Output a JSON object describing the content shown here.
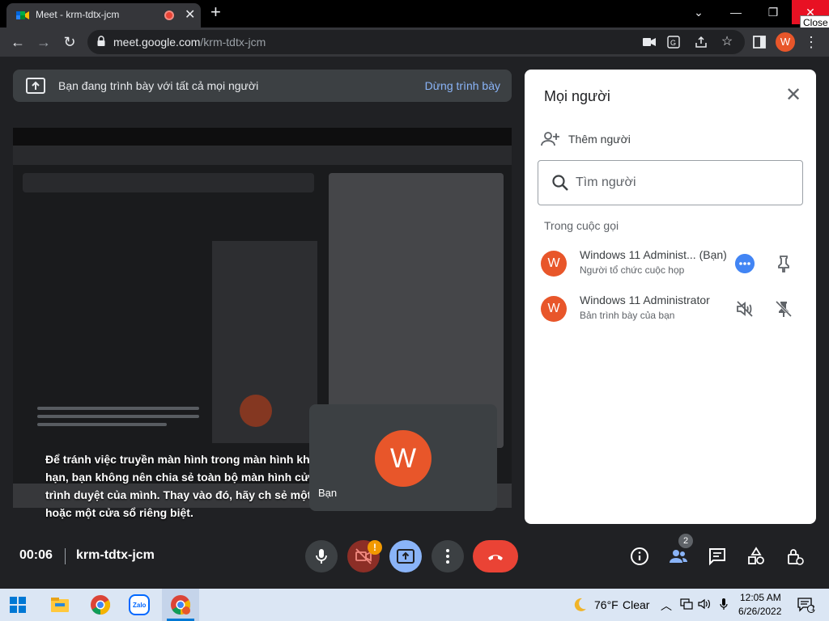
{
  "browser": {
    "tab_title": "Meet - krm-tdtx-jcm",
    "new_tab_symbol": "+",
    "close_tooltip": "Close",
    "url_host": "meet.google.com",
    "url_path": "/krm-tdtx-jcm",
    "profile_initial": "W"
  },
  "banner": {
    "text": "Bạn đang trình bày với tất cả mọi người",
    "stop_label": "Dừng trình bày"
  },
  "stage": {
    "caption": "Để tránh việc truyền màn hình trong màn hình kh giới hạn, bạn không nên chia sẻ toàn bộ màn hình cửa sổ trình duyệt của mình. Thay vào đó, hãy ch sẻ một thẻ hoặc một cửa sổ riêng biệt.",
    "self_initial": "W",
    "self_name": "Bạn"
  },
  "people": {
    "title": "Mọi người",
    "add_label": "Thêm người",
    "search_placeholder": "Tìm người",
    "section_label": "Trong cuộc gọi",
    "participants": [
      {
        "initial": "W",
        "name": "Windows 11 Administ...  (Bạn)",
        "subtitle": "Người tổ chức cuộc họp"
      },
      {
        "initial": "W",
        "name": "Windows 11 Administrator",
        "subtitle": "Bản trình bày của bạn"
      }
    ]
  },
  "controls": {
    "time": "00:06",
    "meeting_code": "krm-tdtx-jcm",
    "warning_badge": "!",
    "people_count": "2"
  },
  "taskbar": {
    "temperature": "76°F",
    "condition": "Clear",
    "time": "12:05 AM",
    "date": "6/26/2022",
    "notification_count": "1"
  },
  "colors": {
    "accent_blue": "#8ab4f8",
    "hangup_red": "#ea4335",
    "avatar_orange": "#e8562a"
  }
}
